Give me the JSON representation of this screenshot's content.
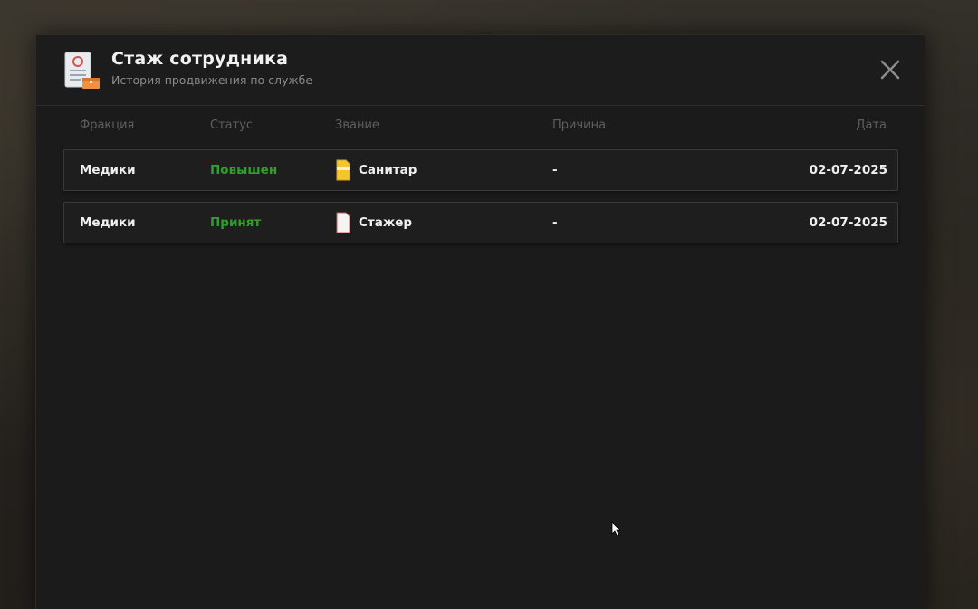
{
  "modal": {
    "title": "Стаж сотрудника",
    "subtitle": "История продвижения по службе"
  },
  "table": {
    "headers": {
      "fraction": "Фракция",
      "status": "Статус",
      "rank": "Звание",
      "reason": "Причина",
      "date": "Дата"
    },
    "rows": [
      {
        "fraction": "Медики",
        "status": "Повышен",
        "rank": "Санитар",
        "rank_icon": "yellow-document-icon",
        "reason": "-",
        "date": "02-07-2025"
      },
      {
        "fraction": "Медики",
        "status": "Принят",
        "rank": "Стажер",
        "rank_icon": "white-document-icon",
        "reason": "-",
        "date": "02-07-2025"
      }
    ]
  },
  "colors": {
    "status_green": "#2e9e2e",
    "modal_bg": "#1b1b1b",
    "rank1_icon": "#f2c531",
    "rank2_icon": "#f4f4f4"
  }
}
